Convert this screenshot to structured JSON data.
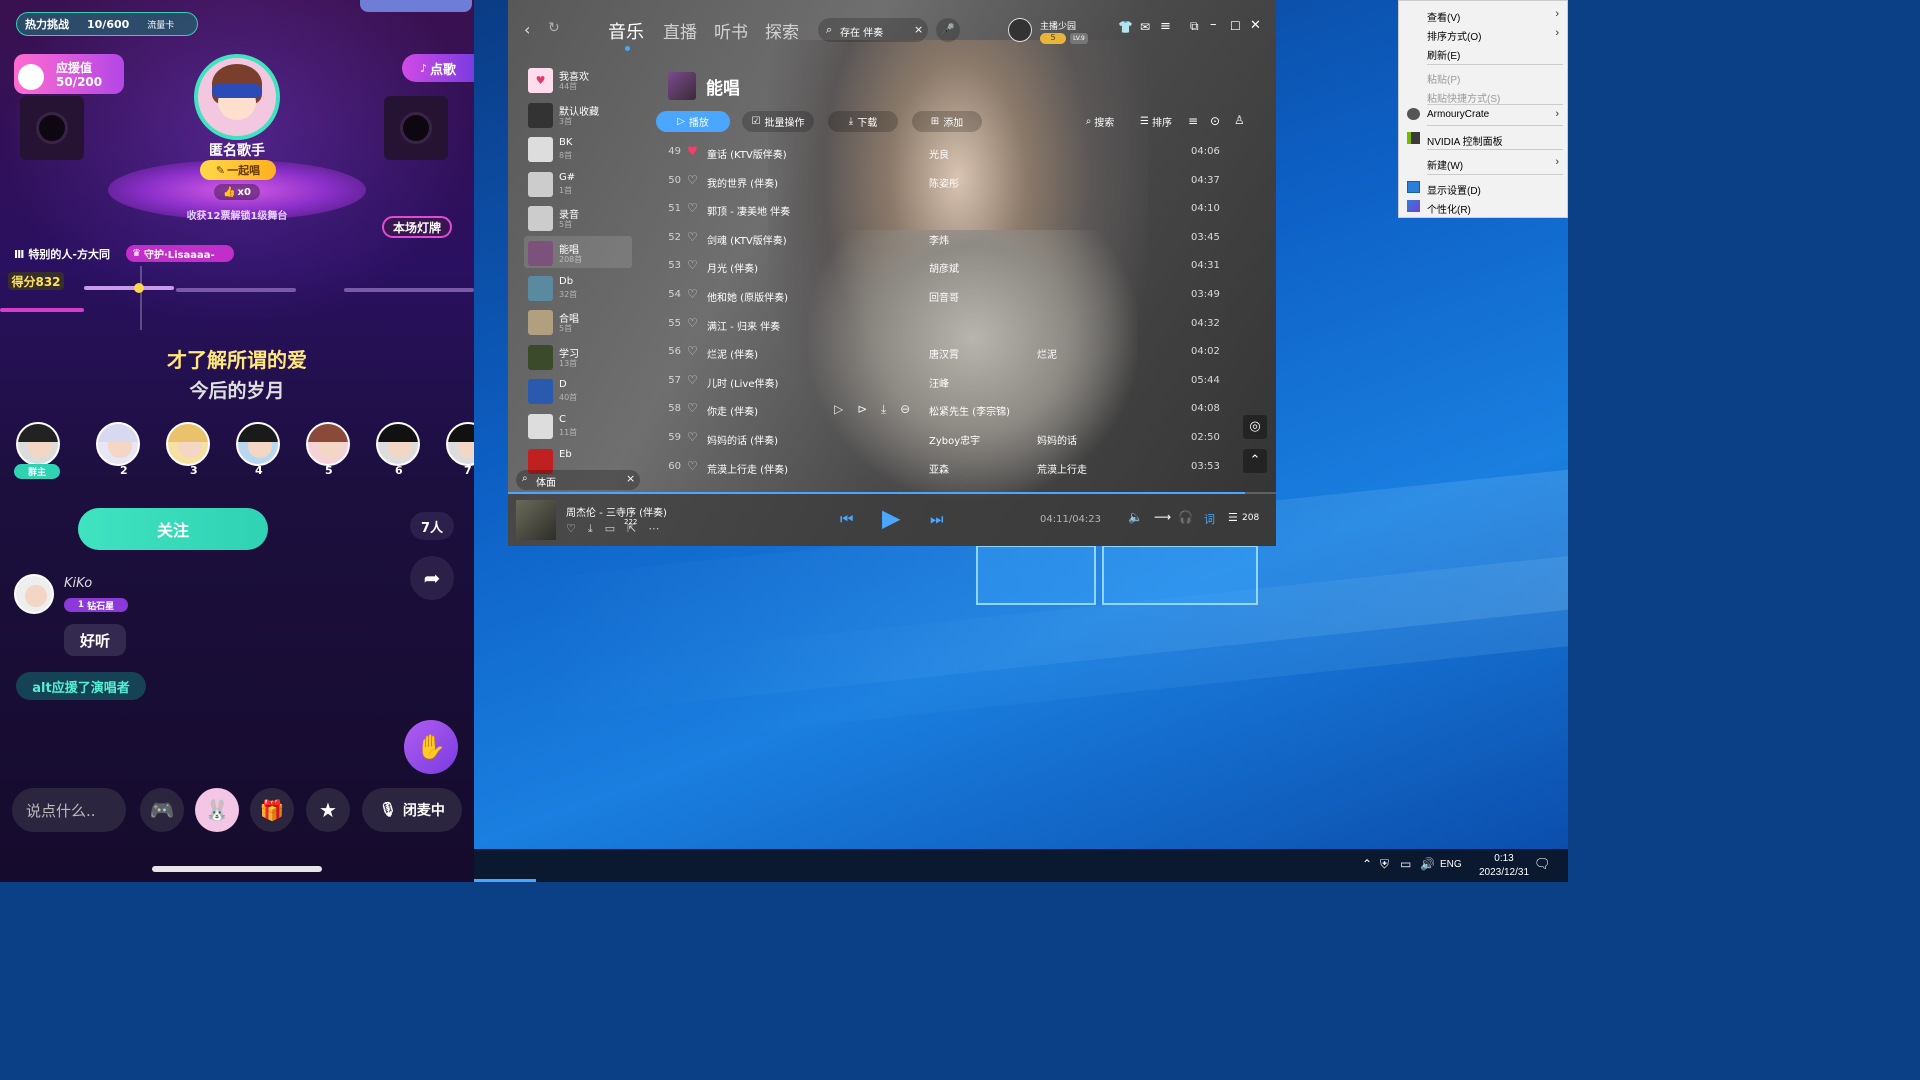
{
  "phone": {
    "top_challenge_label": "热力挑战",
    "top_challenge_value": "10/600",
    "top_challenge_card": "流量卡",
    "support_label": "应援值",
    "support_value": "50/200",
    "request_song": "点歌",
    "singer_name": "匿名歌手",
    "sing_together": "一起唱",
    "like_count": "x0",
    "stage_tip": "收获12票解锁1级舞台",
    "light_button": "本场灯牌",
    "current_song": "特别的人-方大同",
    "guard_badge": "守护·Lisaaaa-",
    "score": "得分832",
    "lyric_current": "才了解所谓的爱",
    "lyric_next": "今后的岁月",
    "seats": [
      {
        "label": "群主"
      },
      {
        "label": "2"
      },
      {
        "label": "3"
      },
      {
        "label": "4"
      },
      {
        "label": "5"
      },
      {
        "label": "6"
      },
      {
        "label": "7"
      }
    ],
    "follow_button": "关注",
    "people_count": "7人",
    "comment_user": "KiKo",
    "comment_level": "钻石星",
    "comment_level_num": "1",
    "comment_text": "好听",
    "system_message": "alt应援了演唱者",
    "input_placeholder": "说点什么..",
    "mic_button": "闭麦中"
  },
  "music": {
    "nav_tabs": [
      "音乐",
      "直播",
      "听书",
      "探索"
    ],
    "search_text": "存在 伴奏",
    "username": "主播少园",
    "user_level": "LV.9",
    "user_badge": "5",
    "sidebar": [
      {
        "name": "我喜欢",
        "count": "44首"
      },
      {
        "name": "默认收藏",
        "count": "3首"
      },
      {
        "name": "BK",
        "count": "8首"
      },
      {
        "name": "G#",
        "count": "1首"
      },
      {
        "name": "录音",
        "count": "5首"
      },
      {
        "name": "能唱",
        "count": "208首"
      },
      {
        "name": "Db",
        "count": "32首"
      },
      {
        "name": "合唱",
        "count": "5首"
      },
      {
        "name": "学习",
        "count": "13首"
      },
      {
        "name": "D",
        "count": "40首"
      },
      {
        "name": "C",
        "count": "11首"
      },
      {
        "name": "Eb",
        "count": ""
      }
    ],
    "sidebar_search": "体面",
    "playlist_title": "能唱",
    "toolbar": {
      "play": "播放",
      "batch": "批量操作",
      "download": "下载",
      "add": "添加",
      "search": "搜索",
      "sort": "排序"
    },
    "songs": [
      {
        "num": "49",
        "title": "童话 (KTV版伴奏)",
        "artist": "光良",
        "album": "",
        "duration": "04:06",
        "liked": true
      },
      {
        "num": "50",
        "title": "我的世界 (伴奏)",
        "artist": "陈姿彤",
        "album": "",
        "duration": "04:37",
        "liked": false
      },
      {
        "num": "51",
        "title": "郭顶 - 凄美地 伴奏",
        "artist": "",
        "album": "",
        "duration": "04:10",
        "liked": false
      },
      {
        "num": "52",
        "title": "剑魂 (KTV版伴奏)",
        "artist": "李炜",
        "album": "",
        "duration": "03:45",
        "liked": false
      },
      {
        "num": "53",
        "title": "月光 (伴奏)",
        "artist": "胡彦斌",
        "album": "",
        "duration": "04:31",
        "liked": false
      },
      {
        "num": "54",
        "title": "他和她 (原版伴奏)",
        "artist": "回音哥",
        "album": "",
        "duration": "03:49",
        "liked": false
      },
      {
        "num": "55",
        "title": "满江 - 归来 伴奏",
        "artist": "",
        "album": "",
        "duration": "04:32",
        "liked": false
      },
      {
        "num": "56",
        "title": "烂泥 (伴奏)",
        "artist": "唐汉霄",
        "album": "烂泥",
        "duration": "04:02",
        "liked": false
      },
      {
        "num": "57",
        "title": "儿时 (Live伴奏)",
        "artist": "汪峰",
        "album": "",
        "duration": "05:44",
        "liked": false
      },
      {
        "num": "58",
        "title": "你走 (伴奏)",
        "artist": "松紧先生 (李宗锦)",
        "album": "",
        "duration": "04:08",
        "liked": false
      },
      {
        "num": "59",
        "title": "妈妈的话 (伴奏)",
        "artist": "Zyboy忠宇",
        "album": "妈妈的话",
        "duration": "02:50",
        "liked": false
      },
      {
        "num": "60",
        "title": "荒漠上行走 (伴奏)",
        "artist": "亚森",
        "album": "荒漠上行走",
        "duration": "03:53",
        "liked": false
      }
    ],
    "player": {
      "now_playing": "周杰伦 - 三寺序 (伴奏)",
      "comment_count": "222",
      "time": "04:11/04:23",
      "lyrics_btn": "词",
      "queue_count": "208",
      "progress": 0.96
    }
  },
  "context_menu": {
    "items": [
      {
        "label": "查看(V)",
        "arrow": true,
        "disabled": false
      },
      {
        "label": "排序方式(O)",
        "arrow": true,
        "disabled": false
      },
      {
        "label": "刷新(E)",
        "arrow": false,
        "disabled": false
      },
      {
        "label": "粘贴(P)",
        "arrow": false,
        "disabled": true
      },
      {
        "label": "粘贴快捷方式(S)",
        "arrow": false,
        "disabled": true
      },
      {
        "label": "ArmouryCrate",
        "arrow": true,
        "disabled": false
      },
      {
        "label": "NVIDIA 控制面板",
        "arrow": false,
        "disabled": false
      },
      {
        "label": "新建(W)",
        "arrow": true,
        "disabled": false
      },
      {
        "label": "显示设置(D)",
        "arrow": false,
        "disabled": false
      },
      {
        "label": "个性化(R)",
        "arrow": false,
        "disabled": false
      }
    ]
  },
  "taskbar": {
    "language": "ENG",
    "time": "0:13",
    "date": "2023/12/31"
  },
  "colors": {
    "accent_green": "#2fd3b4",
    "accent_pink": "#e04bd6",
    "music_blue": "#4aa6ff"
  }
}
